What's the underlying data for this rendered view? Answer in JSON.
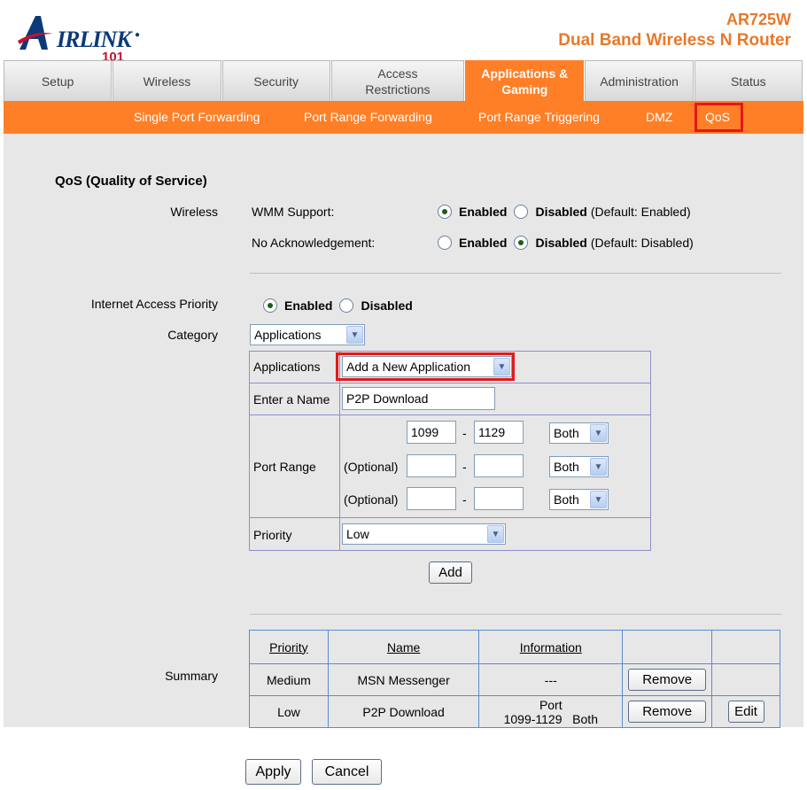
{
  "brand": {
    "logo_text": "IRLINK",
    "logo_a": "A",
    "logo_101": "101",
    "model": "AR725W",
    "product": "Dual Band Wireless N Router"
  },
  "tabs": [
    {
      "label": "Setup"
    },
    {
      "label": "Wireless"
    },
    {
      "label": "Security"
    },
    {
      "label": "Access Restrictions"
    },
    {
      "label": "Applications & Gaming"
    },
    {
      "label": "Administration"
    },
    {
      "label": "Status"
    }
  ],
  "subnav": [
    "Single Port Forwarding",
    "Port Range Forwarding",
    "Port Range Triggering",
    "DMZ",
    "QoS"
  ],
  "qos": {
    "title": "QoS (Quality of Service)",
    "wireless_label": "Wireless",
    "wmm_label": "WMM Support:",
    "noack_label": "No Acknowledgement:",
    "enabled": "Enabled",
    "disabled": "Disabled",
    "wmm_default": "(Default: Enabled)",
    "noack_default": "(Default: Disabled)",
    "iap_label": "Internet Access Priority",
    "category_label": "Category",
    "category_value": "Applications",
    "applications_label": "Applications",
    "applications_value": "Add a New Application",
    "name_label": "Enter a Name",
    "name_value": "P2P Download",
    "port_range_label": "Port Range",
    "optional": "(Optional)",
    "port1_start": "1099",
    "port1_end": "1129",
    "dash": "-",
    "protocol": "Both",
    "priority_label": "Priority",
    "priority_value": "Low",
    "add_button": "Add"
  },
  "summary": {
    "label": "Summary",
    "headers": [
      "Priority",
      "Name",
      "Information"
    ],
    "rows": [
      {
        "priority": "Medium",
        "name": "MSN Messenger",
        "info_line1": "---",
        "info_line2": "",
        "remove": "Remove",
        "edit": ""
      },
      {
        "priority": "Low",
        "name": "P2P Download",
        "info_line1": "Port",
        "info_line2": "1099-1129   Both",
        "remove": "Remove",
        "edit": "Edit"
      }
    ]
  },
  "footer": {
    "apply": "Apply",
    "cancel": "Cancel"
  }
}
